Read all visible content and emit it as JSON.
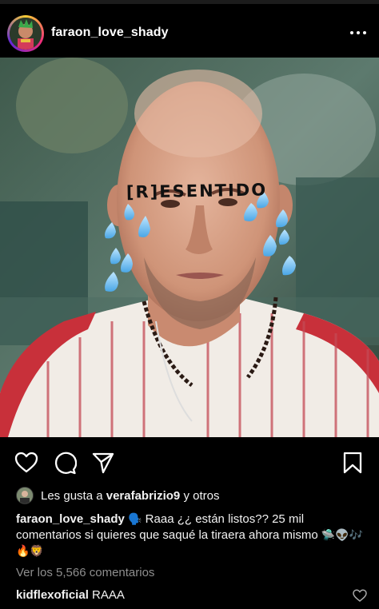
{
  "header": {
    "username": "faraon_love_shady",
    "more_icon": "more-horizontal-icon"
  },
  "post": {
    "overlay_text": "[R]ESENTIDO",
    "image_description_icon": "photo"
  },
  "actions": {
    "like_icon": "heart-icon",
    "comment_icon": "comment-icon",
    "share_icon": "send-icon",
    "save_icon": "bookmark-icon"
  },
  "likes": {
    "prefix": "Les gusta a ",
    "user": "verafabrizio9",
    "suffix": " y otros"
  },
  "caption": {
    "username": "faraon_love_shady",
    "text": " Raaa ¿¿ están listos?? 25 mil comentarios si quieres que saqué la tiraera ahora mismo ",
    "emojis_before": "🗣️",
    "emojis_after": "🛸👽🎶🔥🦁"
  },
  "view_comments": "Ver los 5,566 comentarios",
  "comment": {
    "username": "kidflexoficial",
    "text": " RAAA"
  }
}
